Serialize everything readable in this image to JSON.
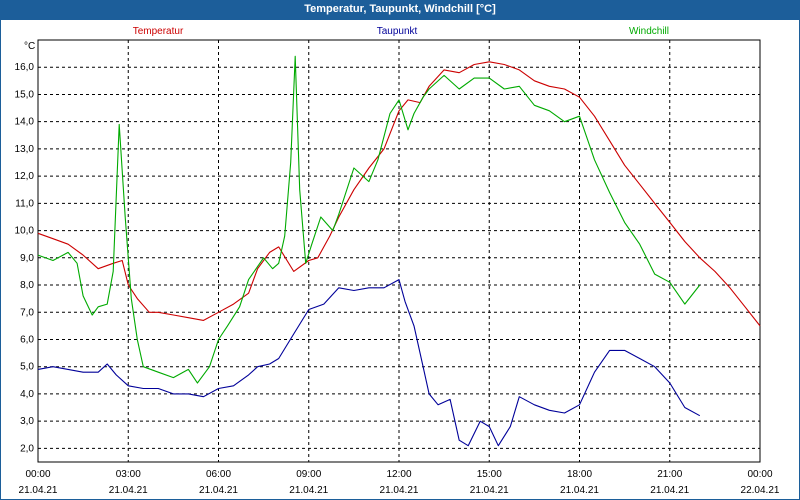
{
  "window": {
    "title": "Temperatur, Taupunkt, Windchill [°C]"
  },
  "chart_data": {
    "type": "line",
    "title": "Temperatur, Taupunkt, Windchill [°C]",
    "ylabel": "°C",
    "ylim": [
      1.5,
      17.0
    ],
    "xlim_hours": [
      0,
      24
    ],
    "grid": true,
    "legend_placement": "top",
    "y_ticks": [
      "2,0",
      "3,0",
      "4,0",
      "5,0",
      "6,0",
      "7,0",
      "8,0",
      "9,0",
      "10,0",
      "11,0",
      "12,0",
      "13,0",
      "14,0",
      "15,0",
      "16,0"
    ],
    "x_ticks": [
      {
        "time": "00:00",
        "date": "21.04.21"
      },
      {
        "time": "03:00",
        "date": "21.04.21"
      },
      {
        "time": "06:00",
        "date": "21.04.21"
      },
      {
        "time": "09:00",
        "date": "21.04.21"
      },
      {
        "time": "12:00",
        "date": "21.04.21"
      },
      {
        "time": "15:00",
        "date": "21.04.21"
      },
      {
        "time": "18:00",
        "date": "21.04.21"
      },
      {
        "time": "21:00",
        "date": "21.04.21"
      },
      {
        "time": "00:00",
        "date": "22.04.21"
      }
    ],
    "series": [
      {
        "name": "Temperatur",
        "color": "#cc0000",
        "x": [
          0,
          0.5,
          1,
          1.5,
          2,
          2.5,
          2.8,
          3,
          3.3,
          3.7,
          4,
          4.5,
          5,
          5.5,
          6,
          6.5,
          7,
          7.3,
          7.7,
          8,
          8.5,
          9,
          9.3,
          9.7,
          10,
          10.5,
          11,
          11.5,
          12,
          12.3,
          12.7,
          13,
          13.5,
          14,
          14.5,
          15,
          15.5,
          16,
          16.5,
          17,
          17.5,
          18,
          18.5,
          19,
          19.5,
          20,
          20.5,
          21,
          21.5,
          22,
          22.5,
          23,
          23.5,
          24
        ],
        "y": [
          9.9,
          9.7,
          9.5,
          9.1,
          8.6,
          8.8,
          8.9,
          8.0,
          7.5,
          7.0,
          7.0,
          6.9,
          6.8,
          6.7,
          7.0,
          7.3,
          7.7,
          8.6,
          9.2,
          9.4,
          8.5,
          8.9,
          9.0,
          9.8,
          10.5,
          11.5,
          12.3,
          13.0,
          14.4,
          14.8,
          14.7,
          15.3,
          15.9,
          15.8,
          16.1,
          16.2,
          16.1,
          15.9,
          15.5,
          15.3,
          15.2,
          14.9,
          14.2,
          13.3,
          12.4,
          11.7,
          11.0,
          10.3,
          9.6,
          9.0,
          8.5,
          7.9,
          7.2,
          6.5
        ]
      },
      {
        "name": "Taupunkt",
        "color": "#000099",
        "x": [
          0,
          0.5,
          1,
          1.5,
          2,
          2.3,
          2.6,
          3,
          3.5,
          4,
          4.5,
          5,
          5.5,
          6,
          6.5,
          7,
          7.3,
          7.7,
          8,
          8.5,
          9,
          9.5,
          10,
          10.5,
          11,
          11.5,
          12,
          12.2,
          12.5,
          12.8,
          13,
          13.3,
          13.7,
          14,
          14.3,
          14.7,
          15,
          15.3,
          15.7,
          16,
          16.5,
          17,
          17.5,
          18,
          18.5,
          19,
          19.5,
          20,
          20.5,
          21,
          21.5,
          22
        ],
        "y": [
          4.9,
          5.0,
          4.9,
          4.8,
          4.8,
          5.1,
          4.7,
          4.3,
          4.2,
          4.2,
          4.0,
          4.0,
          3.9,
          4.2,
          4.3,
          4.7,
          5.0,
          5.1,
          5.3,
          6.2,
          7.1,
          7.3,
          7.9,
          7.8,
          7.9,
          7.9,
          8.2,
          7.4,
          6.5,
          5.0,
          4.0,
          3.6,
          3.8,
          2.3,
          2.1,
          3.0,
          2.8,
          2.1,
          2.8,
          3.9,
          3.6,
          3.4,
          3.3,
          3.6,
          4.8,
          5.6,
          5.6,
          5.3,
          5.0,
          4.4,
          3.5,
          3.2
        ]
      },
      {
        "name": "Windchill",
        "color": "#00aa00",
        "x": [
          0,
          0.5,
          1,
          1.3,
          1.5,
          1.8,
          2,
          2.3,
          2.5,
          2.7,
          2.9,
          3.1,
          3.3,
          3.5,
          4,
          4.5,
          5,
          5.3,
          5.7,
          6,
          6.3,
          6.7,
          7,
          7.5,
          7.8,
          8,
          8.2,
          8.4,
          8.55,
          8.7,
          8.9,
          9.1,
          9.4,
          9.8,
          10,
          10.5,
          11,
          11.3,
          11.7,
          12,
          12.3,
          12.5,
          12.8,
          13,
          13.5,
          14,
          14.5,
          15,
          15.5,
          16,
          16.5,
          17,
          17.5,
          18,
          18.5,
          19,
          19.5,
          20,
          20.5,
          21,
          21.5,
          22
        ],
        "y": [
          9.1,
          8.9,
          9.2,
          8.8,
          7.6,
          6.9,
          7.2,
          7.3,
          8.5,
          13.9,
          10.5,
          7.5,
          6.0,
          5.0,
          4.8,
          4.6,
          4.9,
          4.4,
          5.0,
          6.0,
          6.5,
          7.2,
          8.2,
          9.0,
          8.6,
          8.8,
          9.8,
          12.5,
          16.4,
          11.5,
          8.8,
          9.5,
          10.5,
          10.0,
          10.6,
          12.3,
          11.8,
          12.6,
          14.3,
          14.8,
          13.7,
          14.3,
          14.9,
          15.2,
          15.7,
          15.2,
          15.6,
          15.6,
          15.2,
          15.3,
          14.6,
          14.4,
          14.0,
          14.2,
          12.6,
          11.4,
          10.3,
          9.5,
          8.4,
          8.1,
          7.3,
          8.0
        ]
      }
    ]
  }
}
